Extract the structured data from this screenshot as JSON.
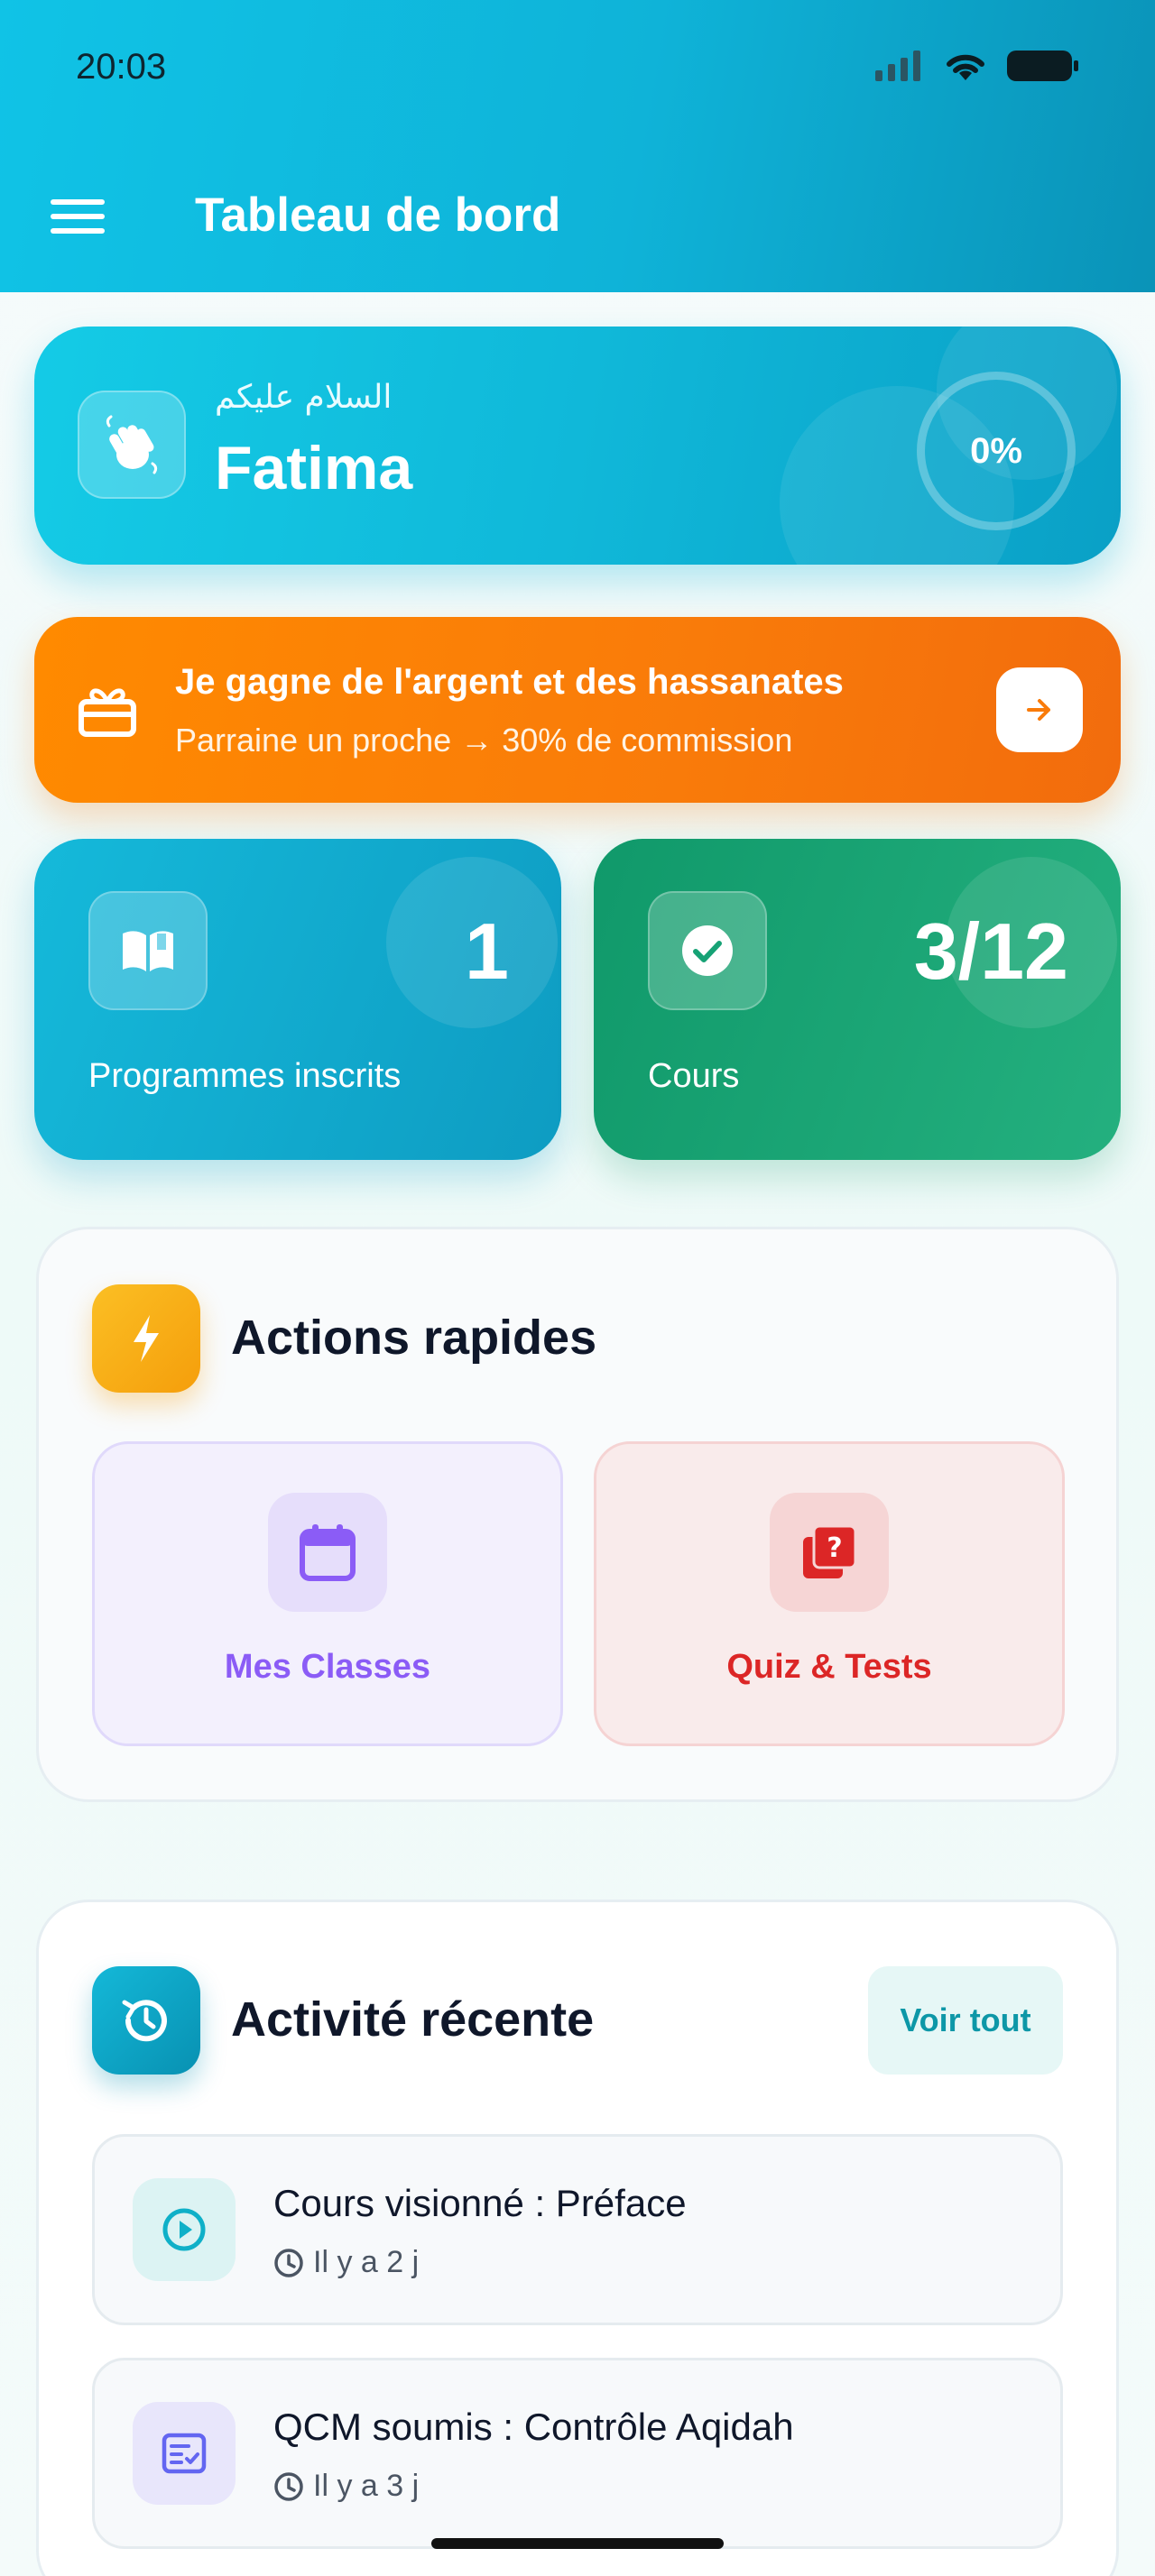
{
  "status_bar": {
    "time": "20:03"
  },
  "header": {
    "title": "Tableau de bord"
  },
  "welcome": {
    "greeting": "السلام عليكم",
    "name": "Fatima",
    "progress": "0%"
  },
  "referral": {
    "title": "Je gagne de l'argent et des hassanates",
    "subtitle": "Parraine un proche → 30% de commission"
  },
  "stats": [
    {
      "value": "1",
      "label": "Programmes inscrits",
      "icon": "open-book-icon"
    },
    {
      "value": "3/12",
      "label": "Cours",
      "icon": "check-circle-icon"
    }
  ],
  "quick_actions": {
    "title": "Actions rapides",
    "items": [
      {
        "label": "Mes Classes",
        "icon": "calendar-icon",
        "color": "#8b5cf6"
      },
      {
        "label": "Quiz & Tests",
        "icon": "quiz-icon",
        "color": "#dc2626"
      }
    ]
  },
  "recent": {
    "title": "Activité récente",
    "see_all": "Voir tout",
    "items": [
      {
        "title": "Cours visionné : Préface",
        "time": "Il y a 2 j",
        "icon": "play-circle-icon"
      },
      {
        "title": "QCM soumis : Contrôle Aqidah",
        "time": "Il y a 3 j",
        "icon": "checklist-icon"
      }
    ]
  },
  "colors": {
    "primary": "#10b8d9",
    "orange": "#f97b0a",
    "green": "#10996a",
    "purple": "#8b5cf6",
    "red": "#dc2626"
  }
}
